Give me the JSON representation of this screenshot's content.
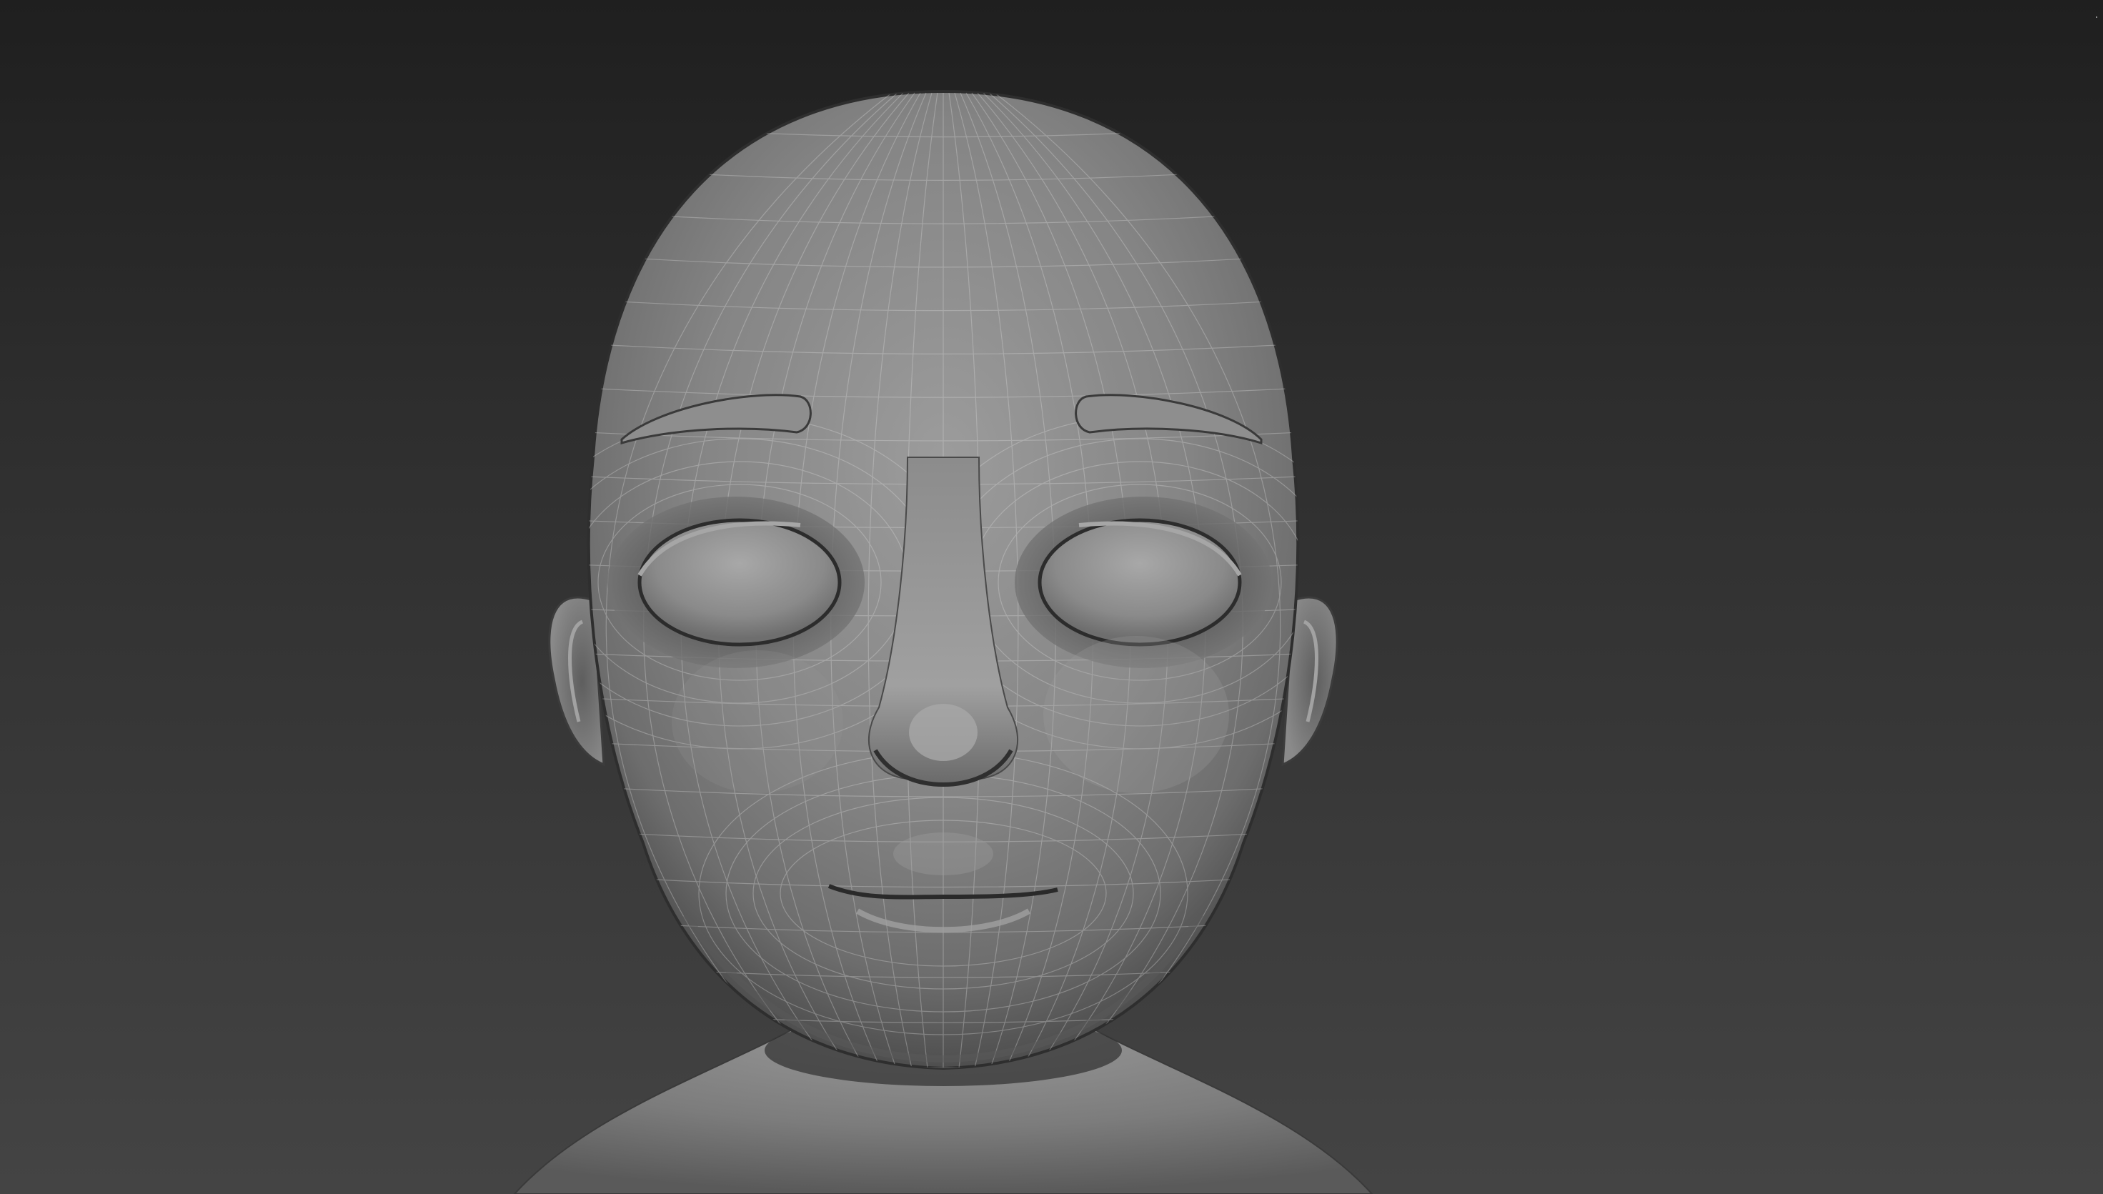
{
  "viewport": {
    "background_top": "#1f1f1f",
    "background_bottom": "#444444"
  },
  "model": {
    "type": "cartoon-head-mesh",
    "shading": "smooth-gray-with-wireframe",
    "skin_color": "#8a8a8a",
    "shadow_color": "#2a2a2a",
    "highlight_color": "#b4b4b4",
    "wire_color": "#d8d8d8"
  },
  "corner_glyph": "·"
}
